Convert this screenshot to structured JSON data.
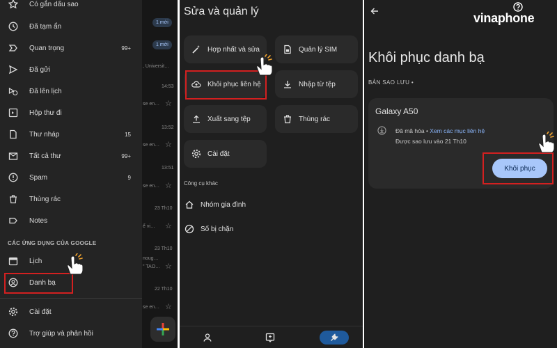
{
  "panel1": {
    "items": [
      {
        "label": "Có gắn dấu sao",
        "count": "",
        "icon": "star-icon"
      },
      {
        "label": "Đã tạm ẩn",
        "count": "",
        "icon": "clock-icon"
      },
      {
        "label": "Quan trọng",
        "count": "99+",
        "icon": "important-icon"
      },
      {
        "label": "Đã gửi",
        "count": "",
        "icon": "send-icon"
      },
      {
        "label": "Đã lên lịch",
        "count": "",
        "icon": "scheduled-icon"
      },
      {
        "label": "Hộp thư đi",
        "count": "",
        "icon": "outbox-icon"
      },
      {
        "label": "Thư nháp",
        "count": "15",
        "icon": "draft-icon"
      },
      {
        "label": "Tất cả thư",
        "count": "99+",
        "icon": "all-mail-icon"
      },
      {
        "label": "Spam",
        "count": "9",
        "icon": "spam-icon"
      },
      {
        "label": "Thùng rác",
        "count": "",
        "icon": "trash-icon"
      },
      {
        "label": "Notes",
        "count": "",
        "icon": "label-icon"
      }
    ],
    "section_header": "CÁC ỨNG DỤNG CỦA GOOGLE",
    "apps": [
      {
        "label": "Lịch",
        "icon": "calendar-icon"
      },
      {
        "label": "Danh bạ",
        "icon": "contacts-icon"
      }
    ],
    "footer": [
      {
        "label": "Cài đặt",
        "icon": "settings-icon"
      },
      {
        "label": "Trợ giúp và phản hồi",
        "icon": "help-icon"
      }
    ],
    "mail_snippets": {
      "badge1": "1 mới",
      "badge2": "1 mới",
      "snippet1": ", Universit…",
      "times": [
        "14:53",
        "13:52",
        "13:51",
        "23 Th10",
        "23 Th10",
        "22 Th10"
      ],
      "fragments": [
        "se en…",
        "se en…",
        "se en…",
        "ể vi…",
        "noug…",
        "\" TAO…",
        "se en…"
      ]
    }
  },
  "panel2": {
    "title": "Sửa và quản lý",
    "tiles": [
      {
        "label": "Hợp nhất và sửa",
        "icon": "magic-wand-icon"
      },
      {
        "label": "Quản lý SIM",
        "icon": "sim-card-icon"
      },
      {
        "label": "Khôi phục liên hệ",
        "icon": "cloud-restore-icon"
      },
      {
        "label": "Nhập từ tệp",
        "icon": "download-icon"
      },
      {
        "label": "Xuất sang tệp",
        "icon": "upload-icon"
      },
      {
        "label": "Thùng rác",
        "icon": "trash-icon"
      },
      {
        "label": "Cài đặt",
        "icon": "settings-icon"
      }
    ],
    "other_tools_header": "Công cụ khác",
    "other_tools": [
      {
        "label": "Nhóm gia đình",
        "icon": "home-icon"
      },
      {
        "label": "Số bị chặn",
        "icon": "blocked-icon"
      }
    ]
  },
  "panel3": {
    "brand": "vinaphone",
    "title": "Khôi phục danh bạ",
    "backups_header": "BẢN SAO LƯU •",
    "device": "Galaxy A50",
    "encrypted": "Đã mã hóa •",
    "view_contacts": "Xem các mục liên hệ",
    "backed_up": "Được sao lưu vào 21 Th10",
    "restore_button": "Khôi phục"
  },
  "colors": {
    "accent_blue": "#a8c7fa",
    "highlight_red": "#d32020",
    "link_blue": "#8ab4f8"
  }
}
